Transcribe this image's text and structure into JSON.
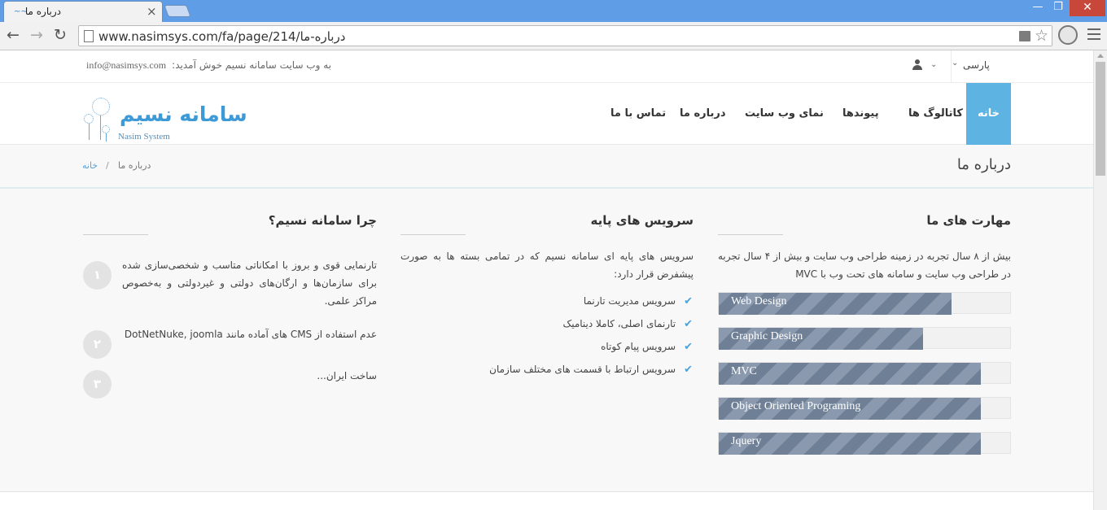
{
  "browser": {
    "tab_title": "درباره ما",
    "tab_favicon": "~~",
    "tab_close": "×",
    "win_min": "—",
    "win_max": "❐",
    "win_close": "✕",
    "back": "←",
    "forward": "→",
    "reload": "↻",
    "url": "www.nasimsys.com/fa/page/214/درباره-ما",
    "star": "☆"
  },
  "topbar": {
    "welcome": "به وب سایت سامانه نسیم خوش آمدید:",
    "email": "info@nasimsys.com",
    "language": "پارسی",
    "chevron": "⌄"
  },
  "logo": {
    "text": "سامانه نسیم",
    "subtitle": "Nasim System"
  },
  "nav": {
    "home": "خانه",
    "catalogs": "کاتالوگ ها",
    "links": "پیوندها",
    "site": "نمای وب سایت",
    "about": "درباره ما",
    "contact": "تماس با ما"
  },
  "breadcrumb": {
    "title": "درباره ما",
    "home": "خانه",
    "separator": "/",
    "current": "درباره ما"
  },
  "skills": {
    "title": "مهارت های ما",
    "description": "بیش از ۸ سال تجربه در زمینه طراحی وب سایت و بیش از ۴ سال تجربه در طراحی وب سایت و سامانه های تحت وب با MVC",
    "items": [
      {
        "label": "Web Design",
        "percent": 80
      },
      {
        "label": "Graphic Design",
        "percent": 70
      },
      {
        "label": "MVC",
        "percent": 90
      },
      {
        "label": "Object Oriented Programing",
        "percent": 90
      },
      {
        "label": "Jquery",
        "percent": 90
      }
    ]
  },
  "services": {
    "title": "سرویس های پایه",
    "description": "سرویس های پایه ای سامانه نسیم که در تمامی بسته ها به صورت پیشفرض قرار دارد:",
    "check_icon": "✔",
    "items": [
      "سرویس مدیریت تارنما",
      "تارنمای اصلی، کاملا دینامیک",
      "سرویس پیام کوتاه",
      "سرویس ارتباط با قسمت های مختلف سازمان"
    ]
  },
  "why": {
    "title": "چرا سامانه نسیم؟",
    "items": [
      {
        "number": "۱",
        "text": "تارنمایی قوی و بروز با امکاناتی متاسب و شخصی‌سازی شده برای سازمان‌ها و ارگان‌های دولتی و غیردولتی و به‌خصوص مراکز علمی."
      },
      {
        "number": "۲",
        "text": "عدم استفاده از CMS های آماده مانند DotNetNuke, joomla"
      },
      {
        "number": "۳",
        "text": "ساخت ایران..."
      }
    ]
  }
}
